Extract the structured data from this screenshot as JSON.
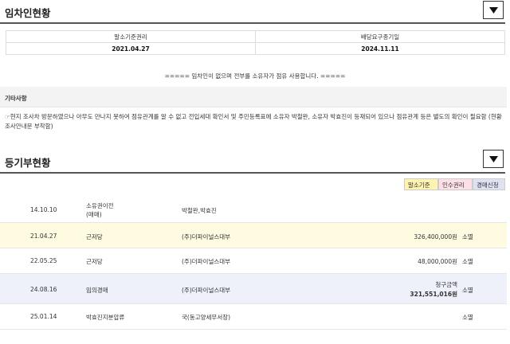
{
  "tenant": {
    "title": "임차인현황",
    "summary_headers": [
      "말소기준권리",
      "배당요구종기일"
    ],
    "summary_values": [
      "2021.04.27",
      "2024.11.11"
    ],
    "notice": "===== 임차인이 없으며 전부를 소유자가 점유 사용합니다. =====",
    "etc_label": "기타사항",
    "etc_text": "☞현지 조사차 방문하였으나 아무도 만나지 못하여 점유관계를 알 수 없고 전입세대 확인서 및 주민등록표에 소유자 박철완, 소유자 박효진이 등재되어 있으나 점유관계 등은 별도의 확인이 필요함 (현황조사안내문 부착함)"
  },
  "registry": {
    "title": "등기부현황",
    "legend": [
      "말소기준",
      "인수권리",
      "경매신청"
    ],
    "colors": {
      "baseline": "#fff3b0",
      "assumed": "#fde0e6",
      "auction": "#dfe2f3"
    },
    "rows": [
      {
        "date": "14.10.10",
        "kind": "소유권이전",
        "sub": "(매매)",
        "holder": "박철완,박효진",
        "amount_label": "",
        "amount": "",
        "status": "",
        "highlight": "none"
      },
      {
        "date": "21.04.27",
        "kind": "근저당",
        "sub": "",
        "holder": "(주)더파이널스대부",
        "amount_label": "",
        "amount": "326,400,000원",
        "status": "소멸",
        "highlight": "baseline"
      },
      {
        "date": "22.05.25",
        "kind": "근저당",
        "sub": "",
        "holder": "(주)더파이널스대부",
        "amount_label": "",
        "amount": "48,000,000원",
        "status": "소멸",
        "highlight": "none"
      },
      {
        "date": "24.08.16",
        "kind": "임의경매",
        "sub": "",
        "holder": "(주)더파이널스대부",
        "amount_label": "청구금액",
        "amount": "321,551,016원",
        "status": "소멸",
        "highlight": "auction"
      },
      {
        "date": "25.01.14",
        "kind": "박효진지분압류",
        "sub": "",
        "holder": "국(동고양세무서장)",
        "amount_label": "",
        "amount": "",
        "status": "소멸",
        "highlight": "none"
      }
    ]
  }
}
